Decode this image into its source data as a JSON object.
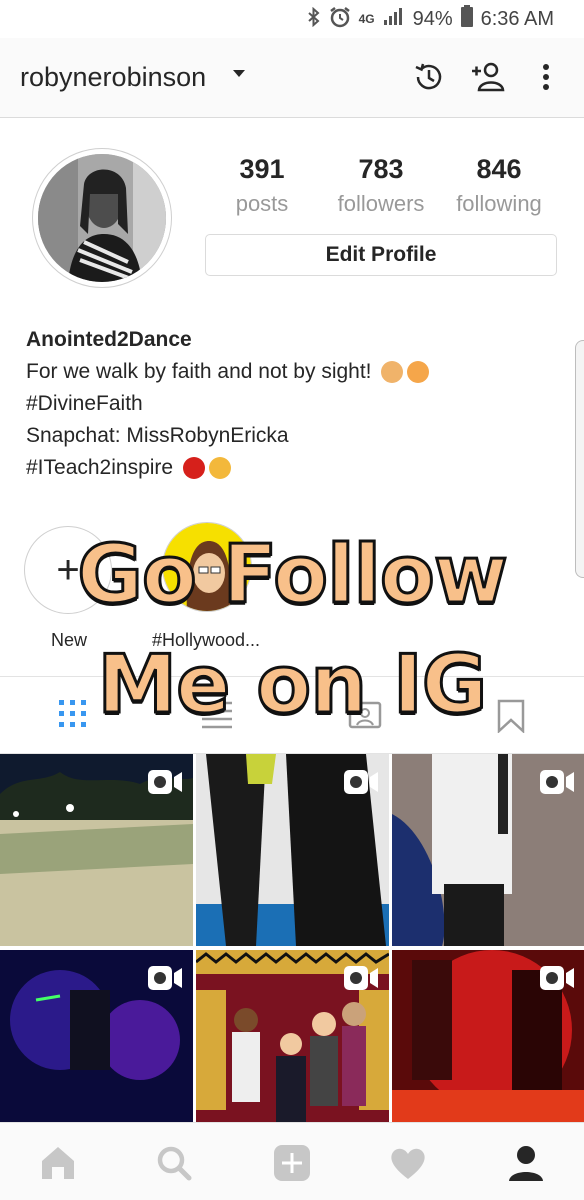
{
  "status_bar": {
    "network": "4G",
    "battery": "94%",
    "time": "6:36 AM",
    "icons": [
      "bluetooth-icon",
      "alarm-icon",
      "signal-icon",
      "battery-icon"
    ]
  },
  "header": {
    "username": "robynerobinson",
    "icons": [
      "history-icon",
      "add-person-icon",
      "more-vertical-icon"
    ]
  },
  "profile": {
    "stats": [
      {
        "value": "391",
        "label": "posts"
      },
      {
        "value": "783",
        "label": "followers"
      },
      {
        "value": "846",
        "label": "following"
      }
    ],
    "edit_button": "Edit Profile",
    "display_name": "Anointed2Dance",
    "bio_lines": [
      "For we walk by faith and not by sight!",
      "#DivineFaith",
      "Snapchat: MissRobynEricka",
      "#ITeach2inspire"
    ]
  },
  "highlights": [
    {
      "label": "New",
      "icon": "plus-icon"
    },
    {
      "label": "#Hollywood..."
    }
  ],
  "overlay_text": [
    "Go Follow",
    "Me on IG"
  ],
  "tabs": [
    "grid-icon",
    "list-icon",
    "tagged-icon",
    "saved-icon"
  ],
  "grid_posts": [
    {
      "type": "video",
      "scene": "baseball-field"
    },
    {
      "type": "video",
      "scene": "dancers-legs"
    },
    {
      "type": "video",
      "scene": "dancer-gym"
    },
    {
      "type": "video",
      "scene": "dance-party-lights"
    },
    {
      "type": "video",
      "scene": "hollywood-group-photo"
    },
    {
      "type": "video",
      "scene": "red-light-dance"
    }
  ],
  "bottom_nav": [
    "home-icon",
    "search-icon",
    "add-post-icon",
    "activity-heart-icon",
    "profile-icon"
  ],
  "colors": {
    "accent_blue": "#3897f0",
    "overlay_fill": "#f8c08a",
    "text": "#262626",
    "muted": "#999999"
  }
}
